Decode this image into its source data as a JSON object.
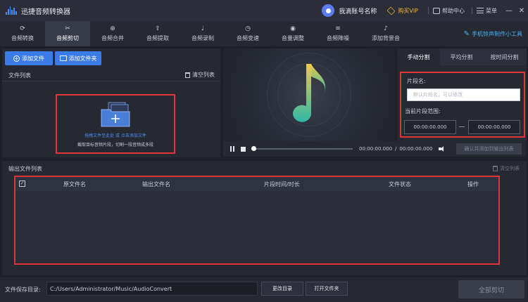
{
  "app": {
    "title": "迅捷音频转换器",
    "account_name": "我滴账号名称",
    "vip_label": "购买VIP",
    "help_label": "帮助中心",
    "menu_label": "菜单",
    "minimize": "—",
    "close": "✕"
  },
  "tabs": [
    {
      "label": "音频转换",
      "icon": "⟳"
    },
    {
      "label": "音频剪切",
      "icon": "✂"
    },
    {
      "label": "音频合并",
      "icon": "⊕"
    },
    {
      "label": "音频提取",
      "icon": "⇪"
    },
    {
      "label": "音频录制",
      "icon": "♩"
    },
    {
      "label": "音频变速",
      "icon": "◷"
    },
    {
      "label": "音量调整",
      "icon": "◉"
    },
    {
      "label": "音频降噪",
      "icon": "≋"
    },
    {
      "label": "添加背景音",
      "icon": "♪"
    }
  ],
  "active_tab": "音频剪切",
  "mobile_tool": {
    "label": "手机铃声制作小工具",
    "icon": "✎"
  },
  "file_panel": {
    "add_file": "添加文件",
    "add_folder": "添加文件夹",
    "list_label": "文件列表",
    "clear_list": "清空列表",
    "drop_hint": "拖拽文件至此处 或 点击添加文件",
    "drop_sub": "截取目标音频片段，切割一段音频成多段"
  },
  "player": {
    "current_time": "00:00:00.000",
    "separator": "/",
    "total_time": "00:00:00.000",
    "confirm_btn": "确认并添加到输出列表",
    "progress": 0
  },
  "split_panel": {
    "tabs": [
      "手动分割",
      "平均分割",
      "按时间分割"
    ],
    "active": "手动分割",
    "segment_name_label": "片段名:",
    "segment_name_placeholder": "默认片段名，可以修改",
    "range_label": "当前片段范围:",
    "start_time": "00:00:00.000",
    "end_time": "00:00:00.000"
  },
  "output": {
    "label": "输出文件列表",
    "clear": "清空列表",
    "columns": [
      "原文件名",
      "输出文件名",
      "片段时间/时长",
      "文件状态",
      "操作"
    ],
    "rows": []
  },
  "footer": {
    "save_dir_label": "文件保存目录:",
    "save_dir": "C:/Users/Administrator/Music/AudioConvert",
    "change_dir": "更改目录",
    "open_folder": "打开文件夹",
    "cut_all": "全部剪切"
  },
  "colors": {
    "accent_blue": "#3b7be8",
    "highlight_red": "#e0333a",
    "vip_gold": "#f5b52b",
    "note_gradient_top": "#f0c84a",
    "note_gradient_bottom": "#2fb8a8"
  }
}
